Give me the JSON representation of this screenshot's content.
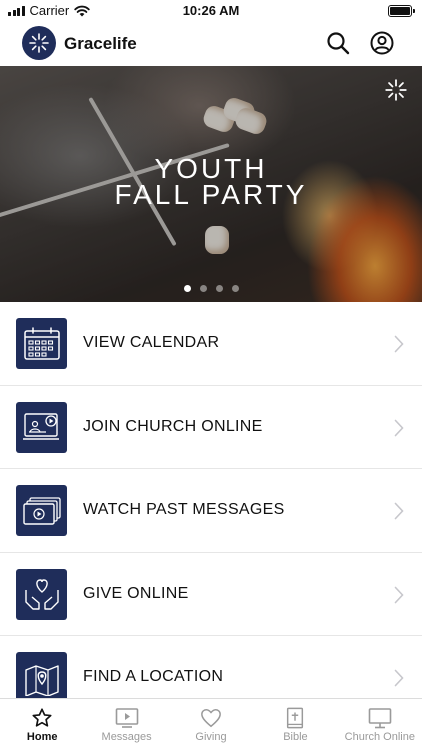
{
  "status_bar": {
    "carrier": "Carrier",
    "time": "10:26 AM"
  },
  "header": {
    "app_name": "Gracelife"
  },
  "hero": {
    "title_line1": "YOUTH",
    "title_line2": "FALL PARTY",
    "carousel_total": 4,
    "carousel_active": 1
  },
  "menu": {
    "items": [
      {
        "label": "VIEW CALENDAR",
        "icon": "calendar-icon"
      },
      {
        "label": "JOIN CHURCH ONLINE",
        "icon": "live-video-icon"
      },
      {
        "label": "WATCH PAST MESSAGES",
        "icon": "video-library-icon"
      },
      {
        "label": "GIVE ONLINE",
        "icon": "giving-hands-icon"
      },
      {
        "label": "FIND A LOCATION",
        "icon": "map-location-icon"
      }
    ]
  },
  "tabbar": {
    "tabs": [
      {
        "label": "Home",
        "icon": "star-icon",
        "active": true
      },
      {
        "label": "Messages",
        "icon": "play-screen-icon",
        "active": false
      },
      {
        "label": "Giving",
        "icon": "heart-icon",
        "active": false
      },
      {
        "label": "Bible",
        "icon": "bible-icon",
        "active": false
      },
      {
        "label": "Church Online",
        "icon": "monitor-icon",
        "active": false
      }
    ]
  },
  "colors": {
    "brand_navy": "#1f2d5a",
    "tab_inactive": "#9a9a9a",
    "divider": "#e6e6e6"
  }
}
